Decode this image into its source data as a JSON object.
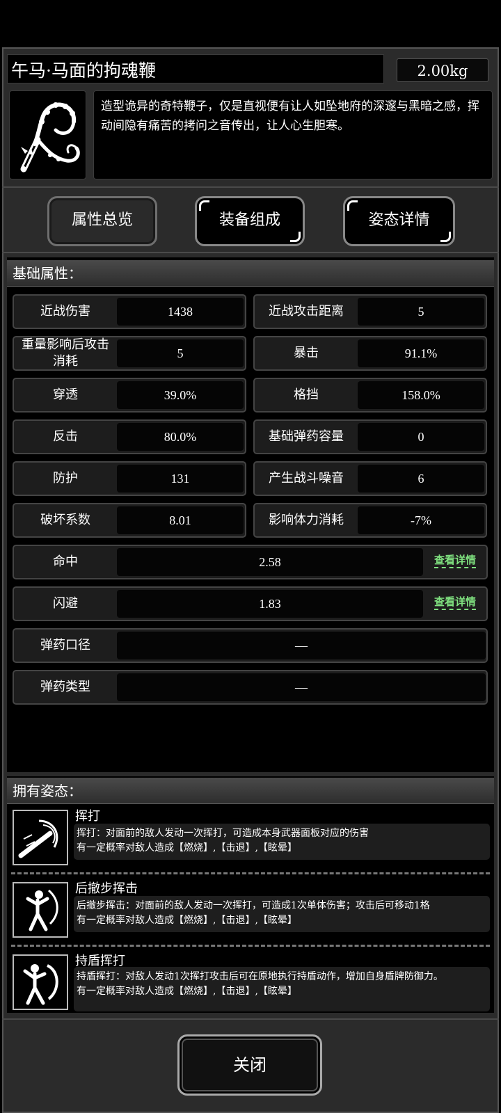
{
  "item": {
    "name": "午马·马面的拘魂鞭",
    "weight": "2.00kg",
    "icon": "whip-icon",
    "description": "造型诡异的奇特鞭子，仅是直视便有让人如坠地府的深邃与黑暗之感，挥动间隐有痛苦的拷问之音传出，让人心生胆寒。"
  },
  "tabs": [
    {
      "label": "属性总览",
      "active": true
    },
    {
      "label": "装备组成",
      "active": false
    },
    {
      "label": "姿态详情",
      "active": false
    }
  ],
  "base_section": {
    "title": "基础属性：",
    "rows": [
      [
        {
          "label": "近战伤害",
          "value": "1438"
        },
        {
          "label": "近战攻击距离",
          "value": "5"
        }
      ],
      [
        {
          "label": "重量影响后攻击消耗",
          "value": "5"
        },
        {
          "label": "暴击",
          "value": "91.1%"
        }
      ],
      [
        {
          "label": "穿透",
          "value": "39.0%"
        },
        {
          "label": "格挡",
          "value": "158.0%"
        }
      ],
      [
        {
          "label": "反击",
          "value": "80.0%"
        },
        {
          "label": "基础弹药容量",
          "value": "0"
        }
      ],
      [
        {
          "label": "防护",
          "value": "131"
        },
        {
          "label": "产生战斗噪音",
          "value": "6"
        }
      ],
      [
        {
          "label": "破坏系数",
          "value": "8.01"
        },
        {
          "label": "影响体力消耗",
          "value": "-7%"
        }
      ]
    ],
    "full_rows": [
      {
        "label": "命中",
        "value": "2.58",
        "link": "查看详情"
      },
      {
        "label": "闪避",
        "value": "1.83",
        "link": "查看详情"
      },
      {
        "label": "弹药口径",
        "value": "—"
      },
      {
        "label": "弹药类型",
        "value": "—"
      }
    ]
  },
  "stance_section": {
    "title": "拥有姿态：",
    "stances": [
      {
        "name": "挥打",
        "icon": "swing-strike-icon",
        "desc_line1": "挥打：对面前的敌人发动一次挥打，可造成本身武器面板对应的伤害",
        "desc_line2": "有一定概率对敌人造成【燃烧】,【击退】,【眩晕】"
      },
      {
        "name": "后撤步挥击",
        "icon": "backstep-strike-icon",
        "desc_line1": "后撤步挥击：对面前的敌人发动一次挥打，可造成1次单体伤害；攻击后可移动1格",
        "desc_line2": "有一定概率对敌人造成【燃烧】,【击退】,【眩晕】"
      },
      {
        "name": "持盾挥打",
        "icon": "shield-strike-icon",
        "desc_line1": "持盾挥打：对敌人发动1次挥打攻击后可在原地执行持盾动作，增加自身盾牌防御力。",
        "desc_line2": "有一定概率对敌人造成【燃烧】,【击退】,【眩晕】"
      }
    ]
  },
  "close_label": "关闭"
}
